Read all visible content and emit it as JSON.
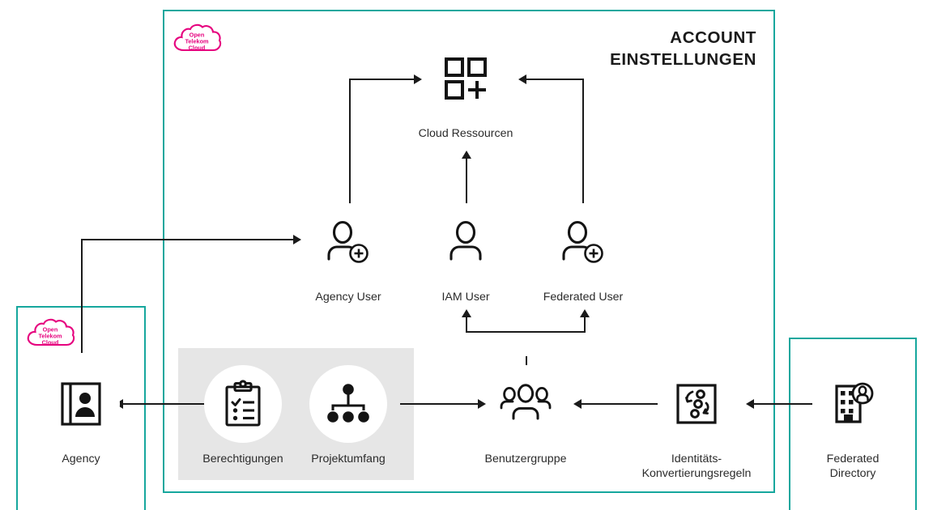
{
  "theme": {
    "teal": "#16a79d",
    "magenta": "#e6007e",
    "ink": "#1a1a1a",
    "label_gray": "#2b2b2b",
    "panel_gray": "#e6e6e6"
  },
  "title": {
    "line1": "ACCOUNT",
    "line2": "EINSTELLUNGEN"
  },
  "logos": {
    "line1": "Open",
    "line2": "Telekom",
    "line3": "Cloud"
  },
  "nodes": {
    "cloud_resources": {
      "label": "Cloud Ressourcen",
      "icon": "cloud-resources-icon"
    },
    "agency_user": {
      "label": "Agency User",
      "icon": "user-add-icon"
    },
    "iam_user": {
      "label": "IAM User",
      "icon": "user-icon"
    },
    "federated_user": {
      "label": "Federated User",
      "icon": "user-add-icon"
    },
    "agency": {
      "label": "Agency",
      "icon": "id-card-icon"
    },
    "permissions": {
      "label": "Berechtigungen",
      "icon": "clipboard-check-icon"
    },
    "project_scope": {
      "label": "Projektumfang",
      "icon": "hierarchy-icon"
    },
    "user_group": {
      "label": "Benutzergruppe",
      "icon": "users-group-icon"
    },
    "identity_rules": {
      "label": "Identitäts-\nKonvertierungsregeln",
      "icon": "identity-conversion-icon"
    },
    "federated_dir": {
      "label": "Federated\nDirectory",
      "icon": "building-user-icon"
    }
  },
  "flows": [
    {
      "name": "agency-to-agency-user",
      "from": "Agency",
      "to": "Agency User"
    },
    {
      "name": "agency-user-to-cloud-resources",
      "from": "Agency User",
      "to": "Cloud Ressourcen"
    },
    {
      "name": "iam-user-to-cloud-resources",
      "from": "IAM User",
      "to": "Cloud Ressourcen"
    },
    {
      "name": "federated-user-to-cloud-resources",
      "from": "Federated User",
      "to": "Cloud Ressourcen"
    },
    {
      "name": "permissions-to-agency",
      "from": "Berechtigungen",
      "to": "Agency"
    },
    {
      "name": "project-scope-to-user-group",
      "from": "Projektumfang",
      "to": "Benutzergruppe"
    },
    {
      "name": "user-group-to-iam-user",
      "from": "Benutzergruppe",
      "to": "IAM User"
    },
    {
      "name": "user-group-to-federated-user",
      "from": "Benutzergruppe",
      "to": "Federated User"
    },
    {
      "name": "identity-rules-to-user-group",
      "from": "Identitäts-Konvertierungsregeln",
      "to": "Benutzergruppe"
    },
    {
      "name": "federated-directory-to-identity-rules",
      "from": "Federated Directory",
      "to": "Identitäts-Konvertierungsregeln"
    }
  ]
}
